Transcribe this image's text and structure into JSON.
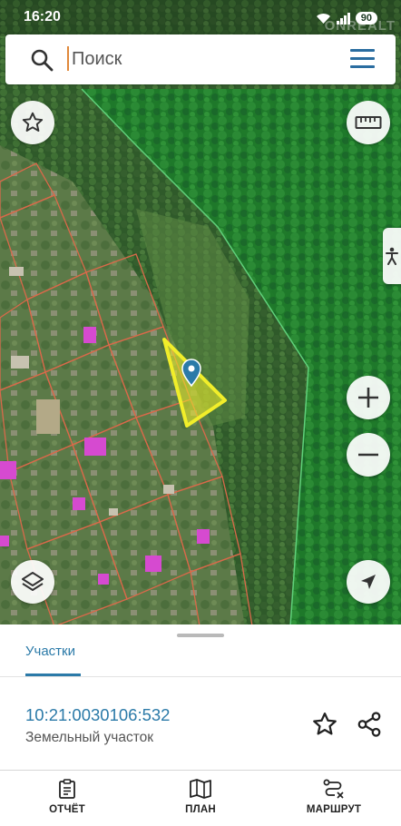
{
  "status_bar": {
    "time": "16:20",
    "battery": "90",
    "watermark": "ONREALT"
  },
  "search": {
    "placeholder": "Поиск"
  },
  "map": {
    "forest_zone_color": "#1f7a2e",
    "parcel_border_color": "#d9694a",
    "selected_parcel_color": "#f1ee2a",
    "marker_color": "#2b7aa8"
  },
  "sheet": {
    "tab_label": "Участки",
    "cadastral_number": "10:21:0030106:532",
    "parcel_type": "Земельный участок"
  },
  "nav": {
    "report_label": "ОТЧЁТ",
    "plan_label": "ПЛАН",
    "route_label": "МАРШРУТ"
  }
}
